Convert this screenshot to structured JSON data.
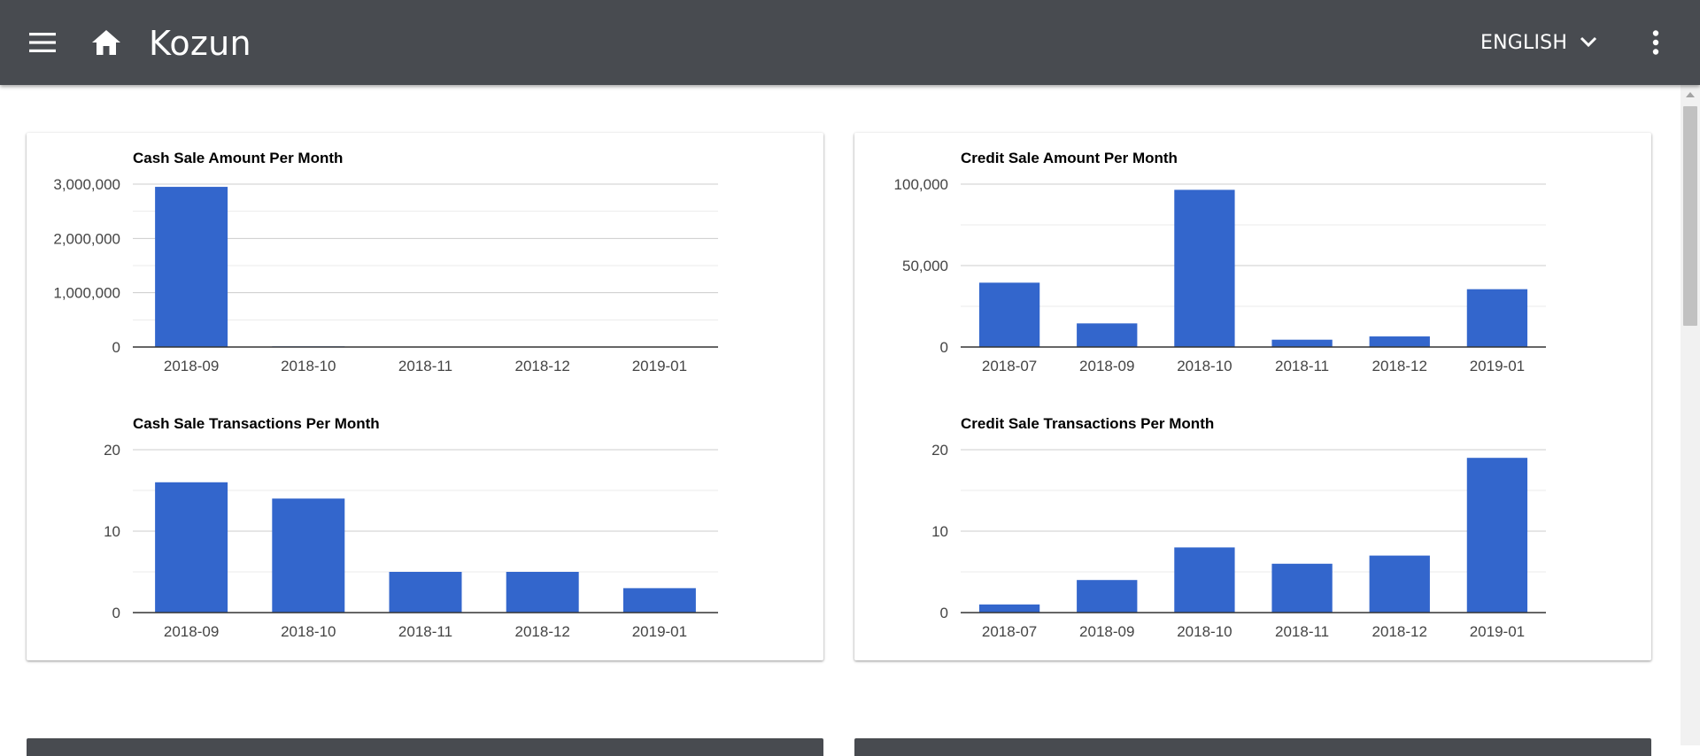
{
  "app": {
    "title": "Kozun",
    "language": "ENGLISH",
    "icons": {
      "menu": "menu-icon",
      "home": "home-icon",
      "language_dropdown": "chevron-down-icon",
      "more": "more-vert-icon"
    }
  },
  "colors": {
    "appbar": "#484b50",
    "bar": "#3366cc",
    "grid": "#cccccc",
    "minor_grid": "#ebebeb"
  },
  "chart_data": [
    {
      "type": "bar",
      "title": "Cash Sale Amount Per Month",
      "categories": [
        "2018-09",
        "2018-10",
        "2018-11",
        "2018-12",
        "2019-01"
      ],
      "values": [
        2950000,
        12000,
        4000,
        8000,
        5000
      ],
      "ylim": [
        0,
        3000000
      ],
      "yticks": [
        0,
        1000000,
        2000000,
        3000000
      ],
      "ytick_labels": [
        "0",
        "1,000,000",
        "2,000,000",
        "3,000,000"
      ],
      "minor_grid": true
    },
    {
      "type": "bar",
      "title": "Cash Sale Transactions Per Month",
      "categories": [
        "2018-09",
        "2018-10",
        "2018-11",
        "2018-12",
        "2019-01"
      ],
      "values": [
        16,
        14,
        5,
        5,
        3
      ],
      "ylim": [
        0,
        20
      ],
      "yticks": [
        0,
        10,
        20
      ],
      "ytick_labels": [
        "0",
        "10",
        "20"
      ],
      "minor_grid": true
    },
    {
      "type": "bar",
      "title": "Credit Sale Amount Per Month",
      "categories": [
        "2018-07",
        "2018-09",
        "2018-10",
        "2018-11",
        "2018-12",
        "2019-01"
      ],
      "values": [
        39500,
        14500,
        96500,
        4500,
        6500,
        35500
      ],
      "ylim": [
        0,
        100000
      ],
      "yticks": [
        0,
        50000,
        100000
      ],
      "ytick_labels": [
        "0",
        "50,000",
        "100,000"
      ],
      "minor_grid": true
    },
    {
      "type": "bar",
      "title": "Credit Sale Transactions Per Month",
      "categories": [
        "2018-07",
        "2018-09",
        "2018-10",
        "2018-11",
        "2018-12",
        "2019-01"
      ],
      "values": [
        1,
        4,
        8,
        6,
        7,
        19
      ],
      "ylim": [
        0,
        20
      ],
      "yticks": [
        0,
        10,
        20
      ],
      "ytick_labels": [
        "0",
        "10",
        "20"
      ],
      "minor_grid": true
    }
  ]
}
